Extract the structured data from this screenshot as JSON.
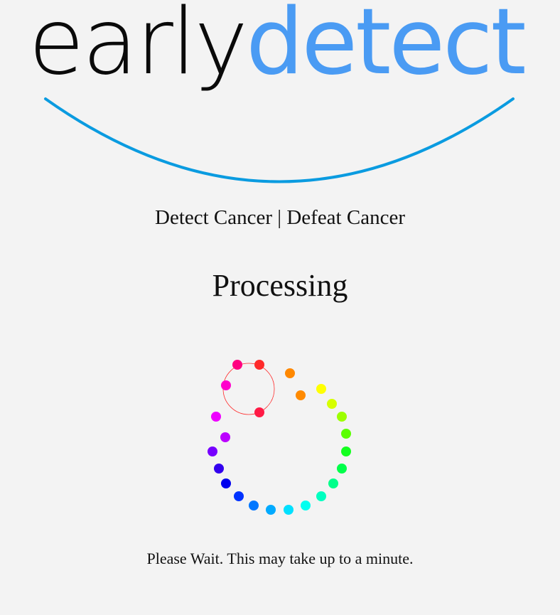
{
  "brand": {
    "part_one": "early",
    "part_two": "detect",
    "accent_color": "#4a9bf3",
    "smile_color": "#0a9be0"
  },
  "tagline": "Detect Cancer | Defeat Cancer",
  "status_heading": "Processing",
  "wait_message": "Please Wait. This may take up to a minute.",
  "spinner": {
    "icon": "loading-spinner-icon",
    "dot_colors": [
      "#ff1a45",
      "#ff2a2a",
      "#ff8800",
      "#ff8a00",
      "#ffff00",
      "#d6ff00",
      "#9cff00",
      "#5aff00",
      "#14ff20",
      "#00ff4a",
      "#00ff8a",
      "#00ffc0",
      "#00fff0",
      "#00e0ff",
      "#00aaff",
      "#0077ff",
      "#0033ff",
      "#0000ee",
      "#3300ee",
      "#7700ff",
      "#bb00ff",
      "#ee00ff",
      "#ff00cc",
      "#ff0080",
      "#ff0050"
    ]
  }
}
